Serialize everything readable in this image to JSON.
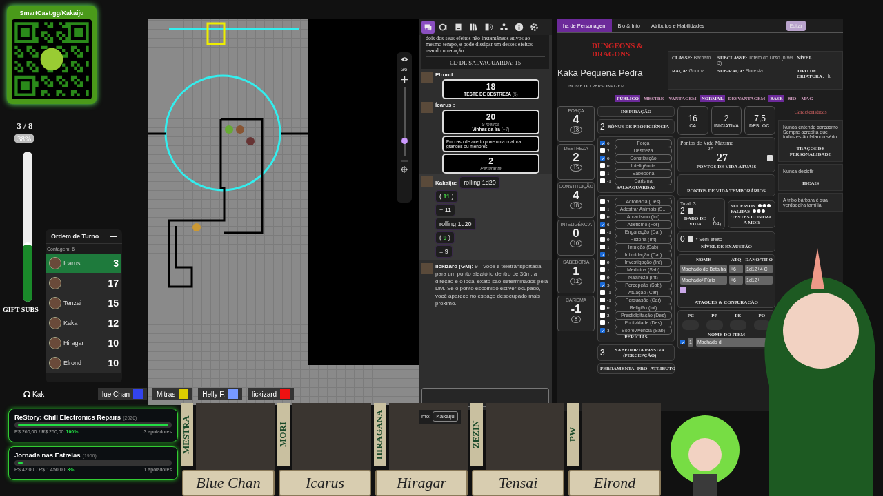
{
  "qr_card": {
    "url": "SmartCast.gg/Kakaiju"
  },
  "gift_meter": {
    "count": "3 / 8",
    "percent": "38%",
    "level": 0.38,
    "label": "GIFT SUBS"
  },
  "map": {
    "zoom": "36",
    "zoom_slider": {
      "level": 0.2
    }
  },
  "turn_order": {
    "title": "Ordem de Turno",
    "count": "Contagem: 6",
    "entries": [
      {
        "name": "Ícarus",
        "value": "3",
        "selected": true
      },
      {
        "value": "17",
        "selected": false
      },
      {
        "name": "Tenzai",
        "value": "15",
        "selected": false
      },
      {
        "name": "Kaka",
        "value": "12",
        "selected": false
      },
      {
        "name": "Hiragar",
        "value": "10",
        "selected": false
      },
      {
        "name": "Elrond",
        "value": "10",
        "selected": false
      }
    ]
  },
  "voice_legend": {
    "speaker": "Kak",
    "players": [
      {
        "name": "lue Chan",
        "color": "#3344ee"
      },
      {
        "name": "Mitras",
        "color": "#ddcc00"
      },
      {
        "name": "Helly F.",
        "color": "#7799ff"
      },
      {
        "name": "lickizard",
        "color": "#ee1111"
      }
    ]
  },
  "donations": [
    {
      "title": "ReStory: Chill Electronics Repairs",
      "year": "(2026)",
      "raised": "R$ 260,00",
      "goal": "/ R$ 250,00",
      "percent": "100%",
      "level": 1,
      "supporters": "3 apoiadores"
    },
    {
      "title": "Jornada nas Estrelas",
      "year": "(1966)",
      "raised": "R$ 42,00",
      "goal": "/ R$ 1.450,00",
      "percent": "3%",
      "level": 0.03,
      "supporters": "1 apoiadores"
    }
  ],
  "chat": {
    "tabs": [
      {
        "selected": true
      },
      {
        "selected": false
      },
      {
        "selected": false
      },
      {
        "selected": false
      },
      {
        "selected": false
      },
      {
        "selected": false
      },
      {
        "selected": false
      },
      {
        "selected": false
      }
    ],
    "spell_text": "dois dos seus efeitos não instantâneos ativos ao mesmo tempo, e pode dissipar um desses efeitos usando uma ação.",
    "spell_dc": "CD DE SALVAGUARDA: 15",
    "roll_cards": [
      {
        "speaker": "Elrond:",
        "total": "18",
        "title": "TESTE DE DESTREZA",
        "modifier": "(5)"
      },
      {
        "speaker": "Ícarus :",
        "total": "20",
        "range": "9 metros",
        "title": "Vinhas da Ira",
        "modifier": "(+7)",
        "description": "Em caso de acerto puxe uma criatura grandes ou menores",
        "damage": "2",
        "damage_type": "Perfurante"
      }
    ],
    "dice_speaker": "Kakaiju:",
    "dice_rolls": [
      {
        "label": "rolling 1d20",
        "open": "(",
        "die": "11",
        "close": ")",
        "result": "= 11"
      },
      {
        "label": "rolling 1d20",
        "open": "(",
        "die": "9",
        "close": ")",
        "result": "= 9"
      }
    ],
    "gm_speaker": "lickizard (GM):",
    "gm_message": "9 - Você é teletransportada para um ponto aleatório dentro de 36m, a direção e o local exato são determinados pela DM. Se o ponto escolhido estiver ocupado, você aparece no espaço desocupado mais próximo.",
    "as_label": "mo:",
    "as_value": "Kakaiju"
  },
  "sheet": {
    "tabs": [
      {
        "label": "ha de Personagem",
        "selected": true
      },
      {
        "label": "Bio & Info",
        "selected": false
      },
      {
        "label": "Atributos e Habilidades",
        "selected": false
      }
    ],
    "edit_button": "Editar",
    "logo": "DUNGEONS & DRAGONS",
    "character_name": "Kaka Pequena Pedra",
    "name_label": "NOME DO PERSONAGEM",
    "info": [
      {
        "label": "CLASSE:",
        "value": "Bárbaro"
      },
      {
        "label": "SUBCLASSE:",
        "value": "Totem do Urso (nível 3)"
      },
      {
        "label": "NÍVEL"
      },
      {
        "label": "RAÇA:",
        "value": "Gnoma"
      },
      {
        "label": "SUB-RAÇA:",
        "value": "Floresta"
      },
      {
        "label": "TIPO DE CRIATURA:",
        "value": "Hu"
      }
    ],
    "toggles": [
      {
        "label": "PÚBLICO",
        "selected": true
      },
      {
        "label": "MESTRE",
        "selected": false
      },
      {
        "label": "VANTAGEM",
        "selected": false
      },
      {
        "label": "NORMAL",
        "selected": true
      },
      {
        "label": "DESVANTAGEM",
        "selected": false
      },
      {
        "label": "BASE",
        "selected": true
      },
      {
        "label": "BIO",
        "selected": false
      },
      {
        "label": "MAG",
        "selected": false
      }
    ],
    "abilities": [
      {
        "name": "FORÇA",
        "modifier": "4",
        "score": "18"
      },
      {
        "name": "DESTREZA",
        "modifier": "2",
        "score": "15"
      },
      {
        "name": "CONSTITUIÇÃO",
        "modifier": "4",
        "score": "18"
      },
      {
        "name": "INTELIGÊNCIA",
        "modifier": "0",
        "score": "10"
      },
      {
        "name": "SABEDORIA",
        "modifier": "1",
        "score": "12"
      },
      {
        "name": "CARISMA",
        "modifier": "-1",
        "score": "8"
      }
    ],
    "inspiration": "INSPIRAÇÃO",
    "proficiency": {
      "value": "2",
      "label": "BÔNUS DE PROFICIÊNCIA"
    },
    "saves": [
      {
        "checked": true,
        "bonus": "6",
        "name": "Força"
      },
      {
        "checked": false,
        "bonus": "2",
        "name": "Destreza"
      },
      {
        "checked": true,
        "bonus": "6",
        "name": "Constituição"
      },
      {
        "checked": false,
        "bonus": "0",
        "name": "Inteligência"
      },
      {
        "checked": false,
        "bonus": "1",
        "name": "Sabedoria"
      },
      {
        "checked": false,
        "bonus": "-1",
        "name": "Carisma"
      }
    ],
    "saves_label": "SALVAGUARDAS",
    "skills": [
      {
        "checked": false,
        "bonus": "2",
        "name": "Acrobacia (Des)"
      },
      {
        "checked": false,
        "bonus": "1",
        "name": "Adestrar Animais (S..."
      },
      {
        "checked": false,
        "bonus": "0",
        "name": "Arcanismo (Int)"
      },
      {
        "checked": true,
        "bonus": "6",
        "name": "Atletismo (For)"
      },
      {
        "checked": false,
        "bonus": "-1",
        "name": "Enganação (Car)"
      },
      {
        "checked": false,
        "bonus": "0",
        "name": "História (Int)"
      },
      {
        "checked": false,
        "bonus": "1",
        "name": "Intuição (Sab)"
      },
      {
        "checked": true,
        "bonus": "1",
        "name": "Intimidação (Car)"
      },
      {
        "checked": false,
        "bonus": "0",
        "name": "Investigação (Int)"
      },
      {
        "checked": false,
        "bonus": "1",
        "name": "Medicina (Sab)"
      },
      {
        "checked": false,
        "bonus": "0",
        "name": "Natureza (Int)"
      },
      {
        "checked": true,
        "bonus": "3",
        "name": "Percepção (Sab)"
      },
      {
        "checked": false,
        "bonus": "-1",
        "name": "Atuação (Car)"
      },
      {
        "checked": false,
        "bonus": "-1",
        "name": "Persuasão (Car)"
      },
      {
        "checked": false,
        "bonus": "0",
        "name": "Religião (Int)"
      },
      {
        "checked": false,
        "bonus": "2",
        "name": "Prestidigitação (Des)"
      },
      {
        "checked": false,
        "bonus": "2",
        "name": "Furtividade (Des)"
      },
      {
        "checked": true,
        "bonus": "3",
        "name": "Sobrevivência (Sab)"
      }
    ],
    "skills_label": "PERÍCIAS",
    "passive": {
      "value": "3",
      "label": "SABEDORIA PASSIVA (PERCEPÇÃO)"
    },
    "tools_headers": [
      "FERRAMENTA",
      "PRO",
      "ATRIBUTO"
    ],
    "stats": [
      {
        "value": "16",
        "label": "CA"
      },
      {
        "value": "2",
        "label": "INICIATIVA"
      },
      {
        "value": "7,5",
        "label": "DESLOC."
      }
    ],
    "hp": {
      "max_label": "Pontos de Vida Máximo",
      "max": "27",
      "current": "27",
      "current_label": "PONTOS DE VIDA ATUAIS",
      "temp_label": "PONTOS DE VIDA TEMPORÁRIOS"
    },
    "hit_dice": {
      "total_label": "Total",
      "total": "3",
      "value": "2",
      "label": "DADO DE VIDA",
      "die": "( D4)"
    },
    "death_saves": {
      "successes_label": "SUCESSOS",
      "failures_label": "FALHAS",
      "label": "TESTES CONTRA A MOR"
    },
    "exhaustion": {
      "value": "0",
      "note": "* Sem efeito",
      "label": "NÍVEL DE EXAUSTÃO"
    },
    "attacks": {
      "headers": [
        "NOME",
        "ATQ",
        "DANO/TIPO"
      ],
      "rows": [
        {
          "name": "Machado de Batalha",
          "attack": "+6",
          "damage": "1d12+4 C"
        },
        {
          "name": "Machado+Fúria",
          "attack": "+6",
          "damage": "1d12+"
        }
      ],
      "label": "ATAQUES & CONJURAÇÃO"
    },
    "coins": [
      "PC",
      "PP",
      "PE",
      "PO"
    ],
    "items": {
      "header": "NOME DO ITEM",
      "rows": [
        {
          "checked": true,
          "quantity": "1",
          "name": "Machado d"
        }
      ]
    },
    "traits": {
      "title": "Características",
      "entries": [
        {
          "text": "Nunca entende sarcasmo Sempre acredita que todos estão falando sério",
          "label": "TRAÇOS DE PERSONALIDADE"
        },
        {
          "text": "Nunca desistir",
          "label": "IDEAIS"
        },
        {
          "text": "A tribo bárbara é sua verdadeira família"
        }
      ]
    }
  },
  "cast": [
    {
      "player": "MESTRA",
      "character": "Blue Chan"
    },
    {
      "player": "MORI",
      "character": "Icarus"
    },
    {
      "player": "HIRAGANA",
      "character": "Hiragar"
    },
    {
      "player": "ZEZIN",
      "character": "Tensai"
    },
    {
      "player": "PW",
      "character": "Elrond"
    }
  ]
}
